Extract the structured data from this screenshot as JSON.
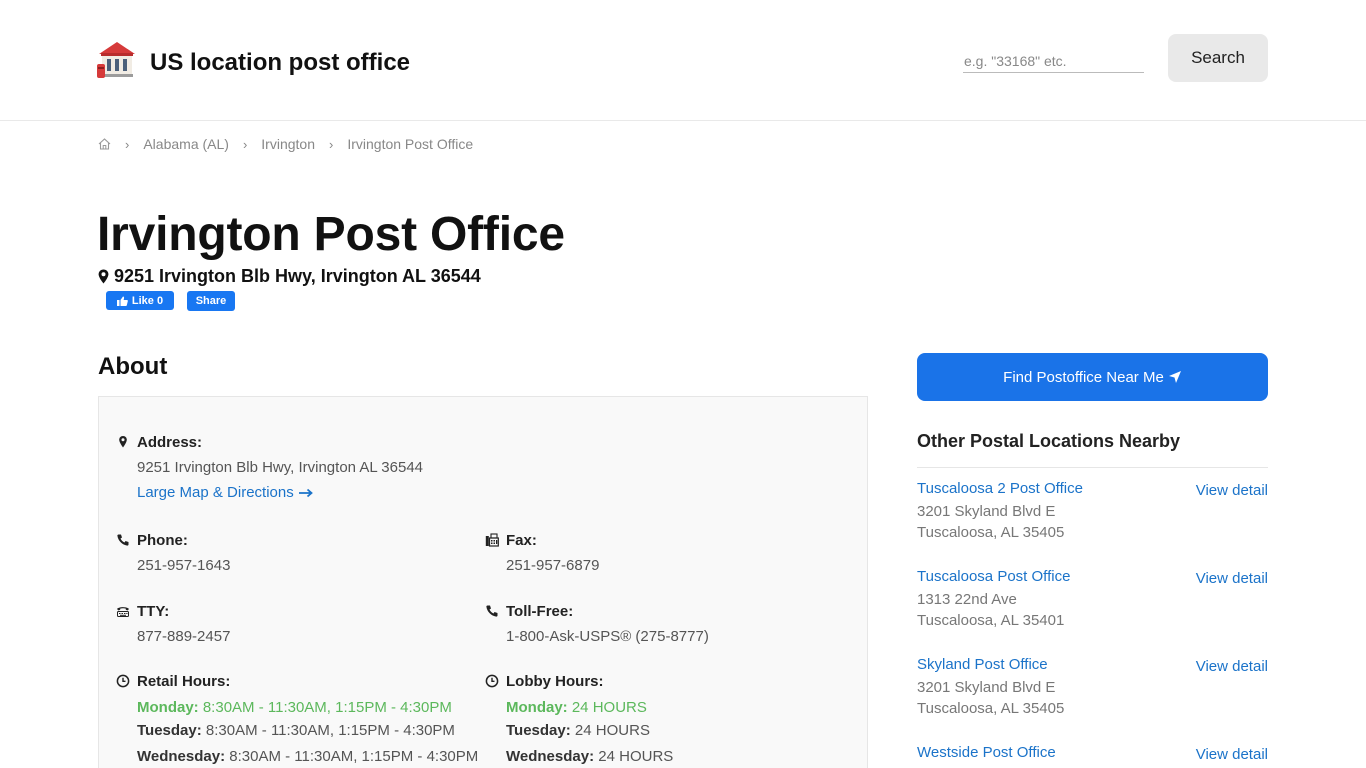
{
  "header": {
    "site_title": "US location post office",
    "search_placeholder": "e.g. \"33168\" etc.",
    "search_button": "Search"
  },
  "breadcrumb": {
    "items": [
      "Alabama (AL)",
      "Irvington",
      "Irvington Post Office"
    ]
  },
  "page": {
    "title": "Irvington Post Office",
    "address": "9251 Irvington Blb Hwy, Irvington AL 36544",
    "fb_like": "Like 0",
    "fb_share": "Share"
  },
  "about": {
    "heading": "About",
    "address_label": "Address:",
    "address_value": "9251 Irvington Blb Hwy, Irvington AL 36544",
    "map_link": "Large Map & Directions",
    "phone_label": "Phone:",
    "phone_value": "251-957-1643",
    "fax_label": "Fax:",
    "fax_value": "251-957-6879",
    "tty_label": "TTY:",
    "tty_value": "877-889-2457",
    "tollfree_label": "Toll-Free:",
    "tollfree_value": "1-800-Ask-USPS® (275-8777)",
    "retail_label": "Retail Hours:",
    "retail_hours": [
      {
        "day": "Monday:",
        "hours": "8:30AM - 11:30AM, 1:15PM - 4:30PM"
      },
      {
        "day": "Tuesday:",
        "hours": "8:30AM - 11:30AM, 1:15PM - 4:30PM"
      },
      {
        "day": "Wednesday:",
        "hours": "8:30AM - 11:30AM, 1:15PM - 4:30PM"
      }
    ],
    "lobby_label": "Lobby Hours:",
    "lobby_hours": [
      {
        "day": "Monday:",
        "hours": "24 HOURS"
      },
      {
        "day": "Tuesday:",
        "hours": "24 HOURS"
      },
      {
        "day": "Wednesday:",
        "hours": "24 HOURS"
      }
    ]
  },
  "sidebar": {
    "find_button": "Find Postoffice Near Me",
    "nearby_heading": "Other Postal Locations Nearby",
    "view_detail": "View detail",
    "nearby": [
      {
        "name": "Tuscaloosa 2 Post Office",
        "street": "3201 Skyland Blvd E",
        "city": "Tuscaloosa, AL 35405"
      },
      {
        "name": "Tuscaloosa Post Office",
        "street": "1313 22nd Ave",
        "city": "Tuscaloosa, AL 35401"
      },
      {
        "name": "Skyland Post Office",
        "street": "3201 Skyland Blvd E",
        "city": "Tuscaloosa, AL 35405"
      },
      {
        "name": "Westside Post Office",
        "street": "",
        "city": ""
      }
    ]
  },
  "colors": {
    "accent_blue": "#1a73e8",
    "link_blue": "#1b73c9",
    "facebook_blue": "#1877f2",
    "today_green": "#5cb85c"
  }
}
